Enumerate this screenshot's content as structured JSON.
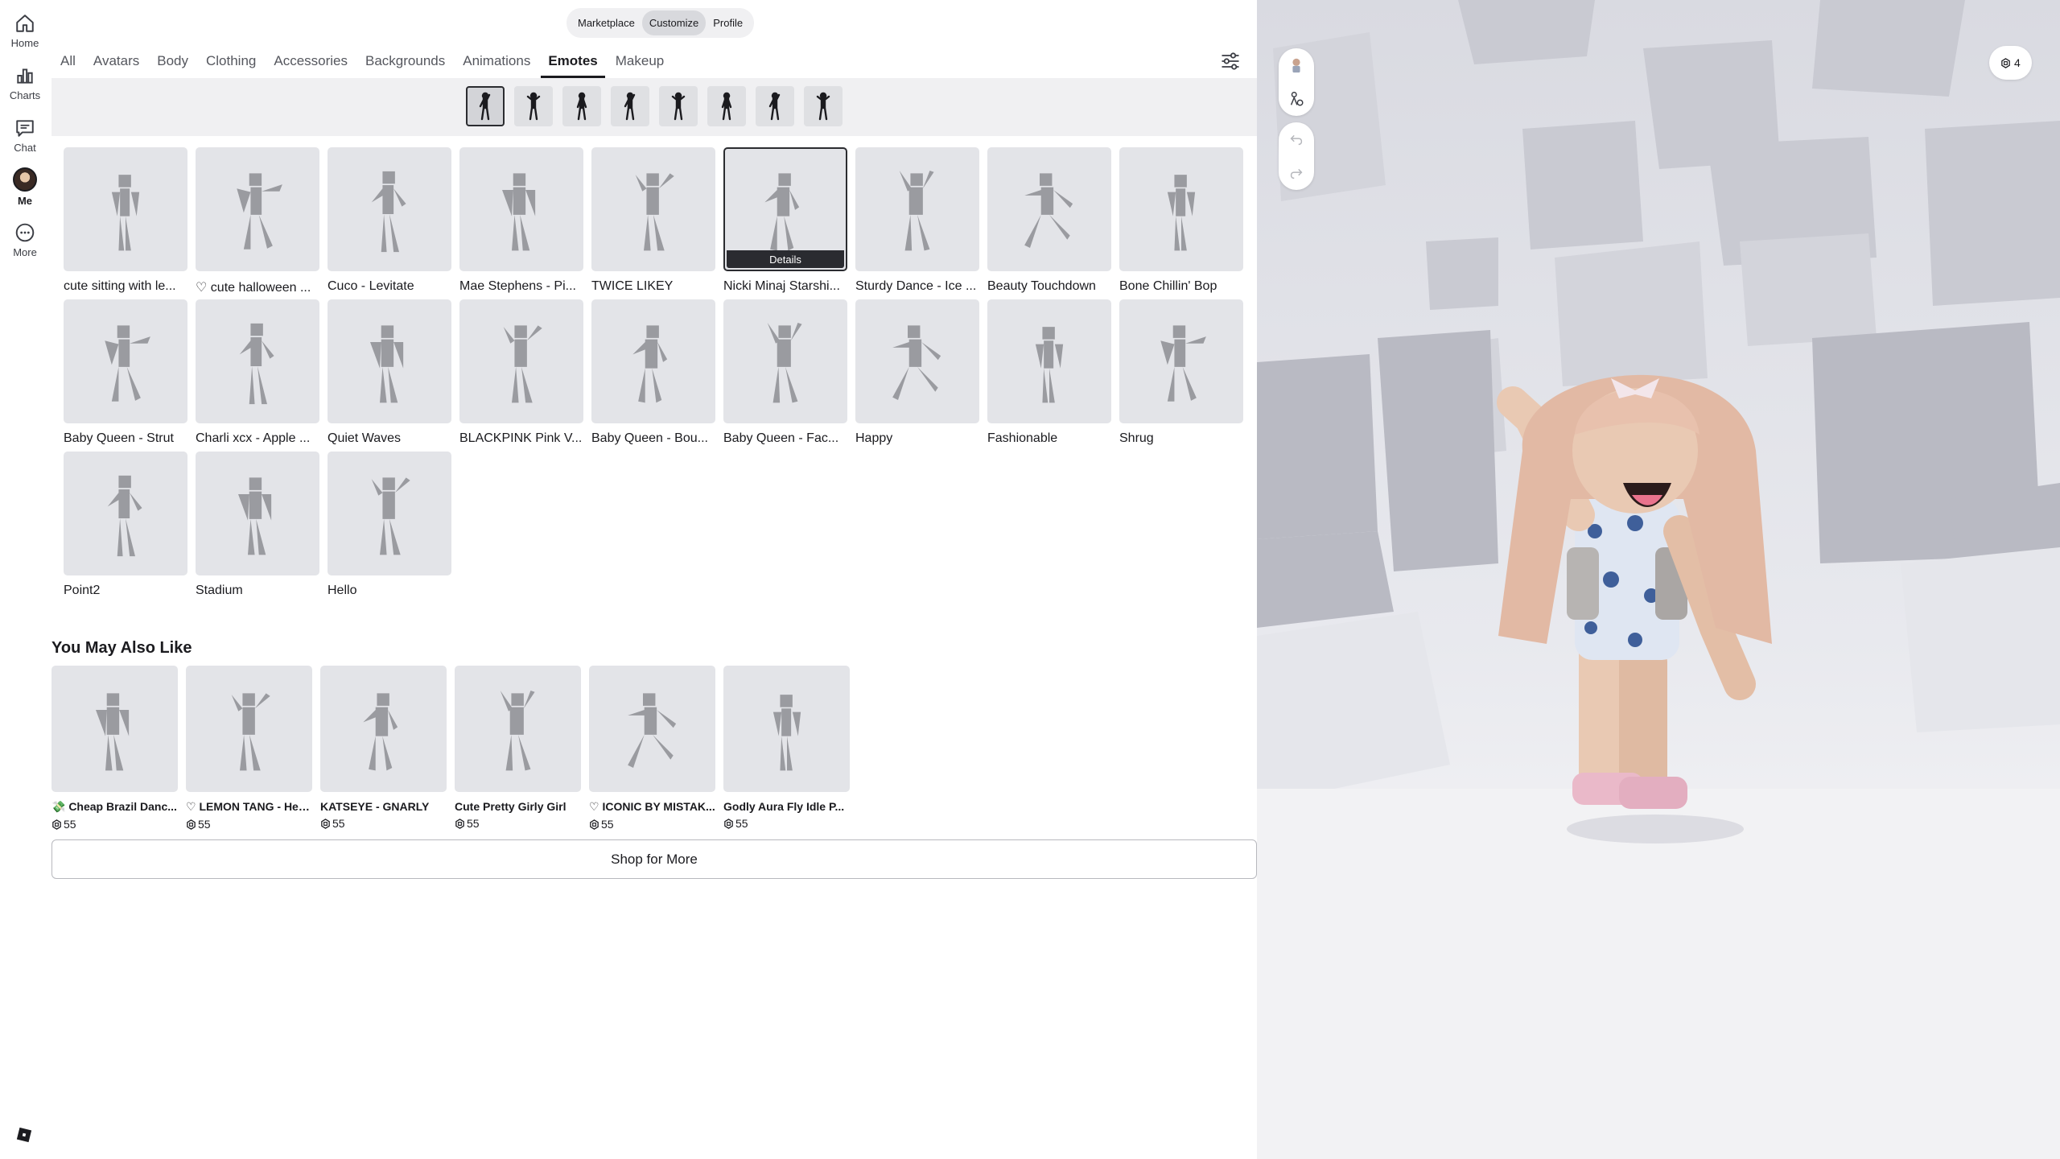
{
  "nav": {
    "items": [
      {
        "label": "Home",
        "icon": "home-icon"
      },
      {
        "label": "Charts",
        "icon": "charts-icon"
      },
      {
        "label": "Chat",
        "icon": "chat-icon"
      },
      {
        "label": "Me",
        "icon": "avatar"
      },
      {
        "label": "More",
        "icon": "more-icon"
      }
    ]
  },
  "switcher": {
    "marketplace": "Marketplace",
    "customize": "Customize",
    "profile": "Profile",
    "active": "Customize"
  },
  "tabs": [
    {
      "label": "All"
    },
    {
      "label": "Avatars"
    },
    {
      "label": "Body"
    },
    {
      "label": "Clothing"
    },
    {
      "label": "Accessories"
    },
    {
      "label": "Backgrounds"
    },
    {
      "label": "Animations"
    },
    {
      "label": "Emotes",
      "active": true
    },
    {
      "label": "Makeup"
    }
  ],
  "emote_slots": {
    "count": 8,
    "selected_index": 0
  },
  "emotes": [
    {
      "name": "cute sitting with le..."
    },
    {
      "name": "♡ cute halloween ..."
    },
    {
      "name": "Cuco - Levitate"
    },
    {
      "name": "Mae Stephens - Pi..."
    },
    {
      "name": "TWICE LIKEY"
    },
    {
      "name": "Nicki Minaj Starshi...",
      "selected": true
    },
    {
      "name": "Sturdy Dance - Ice ..."
    },
    {
      "name": "Beauty Touchdown"
    },
    {
      "name": "Bone Chillin' Bop"
    },
    {
      "name": "Baby Queen - Strut"
    },
    {
      "name": "Charli xcx - Apple ..."
    },
    {
      "name": "Quiet Waves"
    },
    {
      "name": "BLACKPINK Pink V..."
    },
    {
      "name": "Baby Queen - Bou..."
    },
    {
      "name": "Baby Queen - Fac..."
    },
    {
      "name": "Happy"
    },
    {
      "name": "Fashionable"
    },
    {
      "name": "Shrug"
    },
    {
      "name": "Point2"
    },
    {
      "name": "Stadium"
    },
    {
      "name": "Hello"
    }
  ],
  "details_label": "Details",
  "recommendations": {
    "title": "You May Also Like",
    "items": [
      {
        "name": "💸 Cheap Brazil Danc...",
        "price": "55"
      },
      {
        "name": "♡ LEMON TANG - Hea...",
        "price": "55"
      },
      {
        "name": "KATSEYE - GNARLY",
        "price": "55"
      },
      {
        "name": "Cute Pretty Girly Girl",
        "price": "55"
      },
      {
        "name": "♡ ICONIC BY MISTAK...",
        "price": "55"
      },
      {
        "name": "Godly Aura Fly Idle P...",
        "price": "55"
      }
    ],
    "shop_more": "Shop for More"
  },
  "preview": {
    "robux_balance": "4",
    "tools": [
      "avatar-preset-icon",
      "avatar-edit-icon",
      "undo-icon",
      "redo-icon"
    ]
  },
  "colors": {
    "accent": "#1b1b1f",
    "thumb_bg": "#e3e4e8",
    "silhouette": "#9a9ba0",
    "strip_bg": "#f0f0f2"
  }
}
